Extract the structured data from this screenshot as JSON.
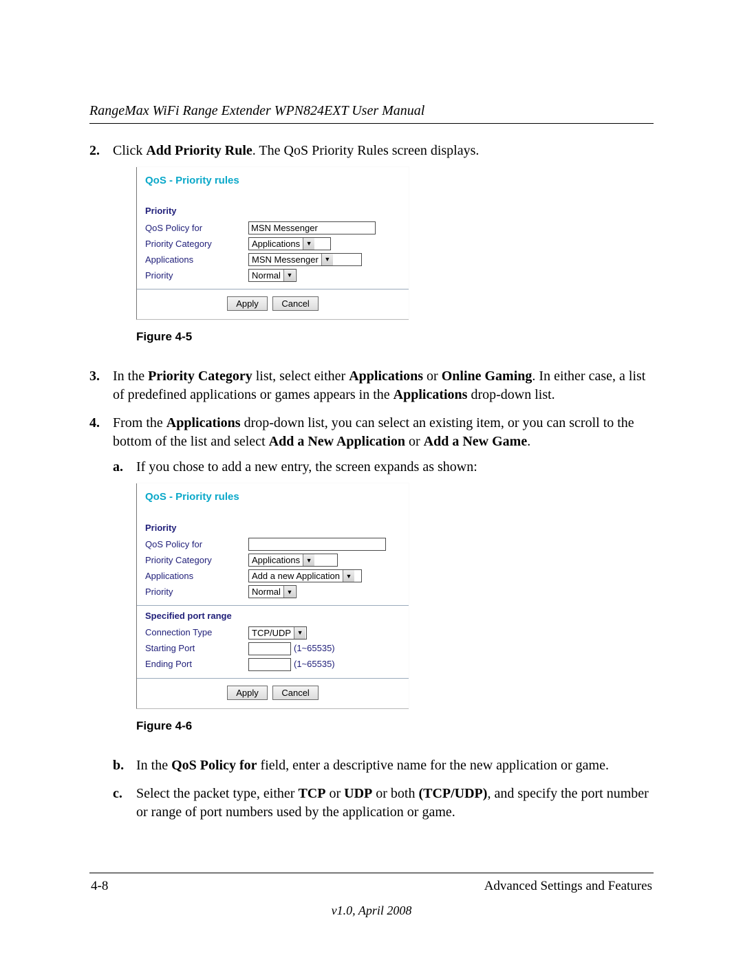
{
  "header": {
    "title": "RangeMax WiFi Range Extender WPN824EXT User Manual"
  },
  "steps": {
    "s2": {
      "num": "2.",
      "text_a": "Click ",
      "bold_a": "Add Priority Rule",
      "text_b": ". The QoS Priority Rules screen displays."
    },
    "fig45_caption": "Figure 4-5",
    "s3": {
      "num": "3.",
      "t1": "In the ",
      "b1": "Priority Category",
      "t2": " list, select either ",
      "b2": "Applications",
      "t3": " or ",
      "b3": "Online Gaming",
      "t4": ". In either case, a list of predefined applications or games appears in the ",
      "b4": "Applications",
      "t5": " drop-down list."
    },
    "s4": {
      "num": "4.",
      "t1": "From the ",
      "b1": "Applications",
      "t2": " drop-down list, you can select an existing item, or you can scroll to the bottom of the list and select ",
      "b2": "Add a New Application",
      "t3": " or ",
      "b3": "Add a New Game",
      "t4": "."
    },
    "s4a": {
      "letter": "a.",
      "text": "If you chose to add a new entry, the screen expands as shown:"
    },
    "fig46_caption": "Figure 4-6",
    "s4b": {
      "letter": "b.",
      "t1": "In the ",
      "b1": "QoS Policy for",
      "t2": " field, enter a descriptive name for the new application or game."
    },
    "s4c": {
      "letter": "c.",
      "t1": "Select the packet type, either ",
      "b1": "TCP",
      "t2": " or ",
      "b2": "UDP",
      "t3": " or both ",
      "b3": "(TCP/UDP)",
      "t4": ", and specify the port number or range of port numbers used by the application or game."
    }
  },
  "panel1": {
    "title": "QoS - Priority rules",
    "heading": "Priority",
    "rows": {
      "policy_label": "QoS Policy for",
      "policy_value": "MSN Messenger",
      "category_label": "Priority Category",
      "category_value": "Applications",
      "apps_label": "Applications",
      "apps_value": "MSN Messenger",
      "priority_label": "Priority",
      "priority_value": "Normal"
    },
    "apply": "Apply",
    "cancel": "Cancel"
  },
  "panel2": {
    "title": "QoS - Priority rules",
    "heading1": "Priority",
    "rows1": {
      "policy_label": "QoS Policy for",
      "policy_value": "",
      "category_label": "Priority Category",
      "category_value": "Applications",
      "apps_label": "Applications",
      "apps_value": "Add a new Application",
      "priority_label": "Priority",
      "priority_value": "Normal"
    },
    "heading2": "Specified port range",
    "rows2": {
      "conn_label": "Connection Type",
      "conn_value": "TCP/UDP",
      "start_label": "Starting Port",
      "start_hint": "(1~65535)",
      "end_label": "Ending Port",
      "end_hint": "(1~65535)"
    },
    "apply": "Apply",
    "cancel": "Cancel"
  },
  "footer": {
    "page": "4-8",
    "section": "Advanced Settings and Features",
    "version": "v1.0, April 2008"
  }
}
